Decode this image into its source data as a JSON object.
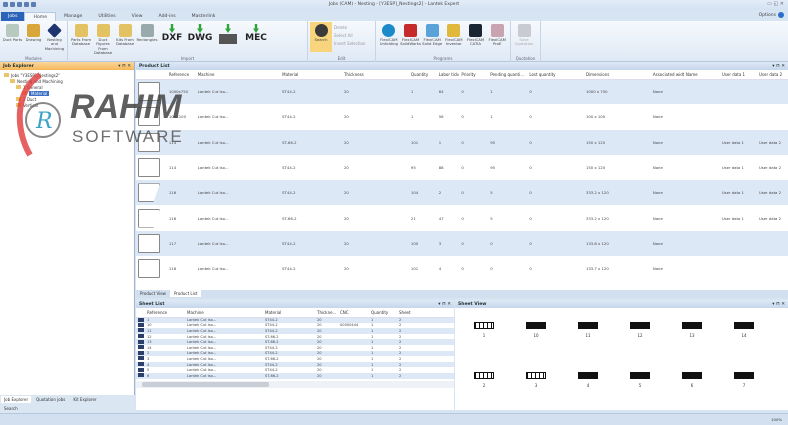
{
  "window": {
    "title": "Jobs (CAM) - Nesting - [Y3ESP]_Nestings2] - Lantek Expert",
    "controls": "▭ ◱ ✕"
  },
  "tabs": [
    "Jobs",
    "Home",
    "Manage",
    "Utilities",
    "View",
    "Add-ins",
    "Masterlink"
  ],
  "options_label": "Options",
  "ribbon": {
    "groups": [
      {
        "label": "Modules",
        "buttons": [
          "Duct Parts",
          "Drawing",
          "Nesting and Machining"
        ]
      },
      {
        "label": "Import",
        "buttons": [
          "Parts From Database",
          "Duct Figures From Database",
          "Kits From Database",
          "Rectangles"
        ],
        "formats": [
          "DXF",
          "DWG",
          "",
          "MEC"
        ]
      },
      {
        "label": "Edit",
        "buttons": [
          "Search"
        ],
        "small": [
          "Delete",
          "Select All",
          "Invert Selection"
        ]
      },
      {
        "label": "Programs",
        "buttons": [
          "FlexiCAM Unfolding",
          "FlexiCAM SolidWorks",
          "FlexiCAM Solid Edge",
          "FlexiCAM Inventor",
          "FlexiCAM CATIA",
          "FlexiCAM ProE"
        ]
      },
      {
        "label": "Quotation",
        "buttons": [
          "Save Quotation"
        ]
      }
    ],
    "colors": {
      "accent": "#2a63b8",
      "import_arrow": "#2fa33a"
    }
  },
  "job_explorer": {
    "title": "Job Explorer",
    "tree": [
      "Jobs \"Y3ESP]_Nestings2\"",
      "Nesting and Machining",
      "1 General",
      "Material",
      "2 Duct",
      "Vertical"
    ],
    "tabs": [
      "Job Explorer",
      "Quotation jobs",
      "Kit Explorer",
      "Search"
    ]
  },
  "product_list": {
    "title": "Product List",
    "columns": [
      "",
      "Reference",
      "Machine",
      "Material",
      "Thickness",
      "Quantity",
      "Labor ticket",
      "Priority",
      "Pending quanti...",
      "Lost quantity",
      "Dimensions",
      "Associated width",
      "Name",
      "User data 1",
      "User data 2"
    ],
    "rows": [
      [
        "",
        "1000x750",
        "Lantek Cut Iso...",
        "ST44-2",
        "20",
        "1",
        "64",
        "0",
        "1",
        "0",
        "1000 x 750",
        "None",
        "",
        "",
        ""
      ],
      [
        "",
        "100X100",
        "Lantek Cut Iso...",
        "ST44-2",
        "20",
        "1",
        "56",
        "0",
        "1",
        "0",
        "100 x 100",
        "None",
        "",
        "",
        ""
      ],
      [
        "",
        "114",
        "Lantek Cut Iso...",
        "ST-66-2",
        "20",
        "101",
        "1",
        "0",
        "95",
        "0",
        "150 x 120",
        "None",
        "",
        "User data 1",
        "User data 2"
      ],
      [
        "",
        "114",
        "Lantek Cut Iso...",
        "ST44-2",
        "20",
        "95",
        "88",
        "0",
        "95",
        "0",
        "150 x 120",
        "None",
        "",
        "User data 1",
        "User data 2"
      ],
      [
        "",
        "116",
        "Lantek Cut Iso...",
        "ST44-2",
        "20",
        "104",
        "2",
        "0",
        "5",
        "0",
        "333.2 x 120",
        "None",
        "",
        "User data 1",
        "User data 2"
      ],
      [
        "",
        "116",
        "Lantek Cut Iso...",
        "ST-66-2",
        "20",
        "21",
        "47",
        "0",
        "5",
        "0",
        "333.2 x 120",
        "None",
        "",
        "User data 1",
        "User data 2"
      ],
      [
        "",
        "117",
        "Lantek Cut Iso...",
        "ST44-2",
        "20",
        "100",
        "3",
        "0",
        "0",
        "0",
        "133.8 x 120",
        "None",
        "",
        "",
        ""
      ],
      [
        "",
        "118",
        "Lantek Cut Iso...",
        "ST44-2",
        "20",
        "101",
        "4",
        "0",
        "0",
        "0",
        "133.7 x 120",
        "None",
        "",
        "",
        ""
      ]
    ],
    "view_tabs": [
      "Product View",
      "Product List"
    ]
  },
  "sheet_list": {
    "title": "Sheet List",
    "columns": [
      "",
      "Reference",
      "Machine",
      "Material",
      "Thickne...",
      "CNC",
      "Quantity",
      "Sheet"
    ],
    "rows": [
      [
        "",
        "1",
        "Lantek Cut Iso...",
        "ST44-2",
        "20",
        "",
        "1",
        "2"
      ],
      [
        "",
        "10",
        "Lantek Cut Iso...",
        "ST44-2",
        "20",
        "00000444",
        "1",
        "2"
      ],
      [
        "",
        "11",
        "Lantek Cut Iso...",
        "ST44-2",
        "20",
        "",
        "1",
        "2"
      ],
      [
        "",
        "12",
        "Lantek Cut Iso...",
        "ST-66-2",
        "20",
        "",
        "1",
        "2"
      ],
      [
        "",
        "13",
        "Lantek Cut Iso...",
        "ST-66-2",
        "20",
        "",
        "1",
        "2"
      ],
      [
        "",
        "14",
        "Lantek Cut Iso...",
        "ST44-2",
        "20",
        "",
        "1",
        "2"
      ],
      [
        "",
        "2",
        "Lantek Cut Iso...",
        "ST44-2",
        "20",
        "",
        "1",
        "2"
      ],
      [
        "",
        "3",
        "Lantek Cut Iso...",
        "ST-66-2",
        "20",
        "",
        "1",
        "2"
      ],
      [
        "",
        "4",
        "Lantek Cut Iso...",
        "ST44-2",
        "20",
        "",
        "1",
        "2"
      ],
      [
        "",
        "5",
        "Lantek Cut Iso...",
        "ST44-2",
        "20",
        "",
        "1",
        "2"
      ],
      [
        "",
        "6",
        "Lantek Cut Iso...",
        "ST-66-2",
        "20",
        "",
        "1",
        "2"
      ]
    ]
  },
  "sheet_view": {
    "title": "Sheet View",
    "sheets": [
      "1",
      "10",
      "11",
      "12",
      "13",
      "14",
      "2",
      "3",
      "4",
      "5",
      "6",
      "7"
    ]
  },
  "watermark": {
    "line1": "RAHIM",
    "line2": "SOFTWARE"
  },
  "status": {
    "right": "100%"
  }
}
